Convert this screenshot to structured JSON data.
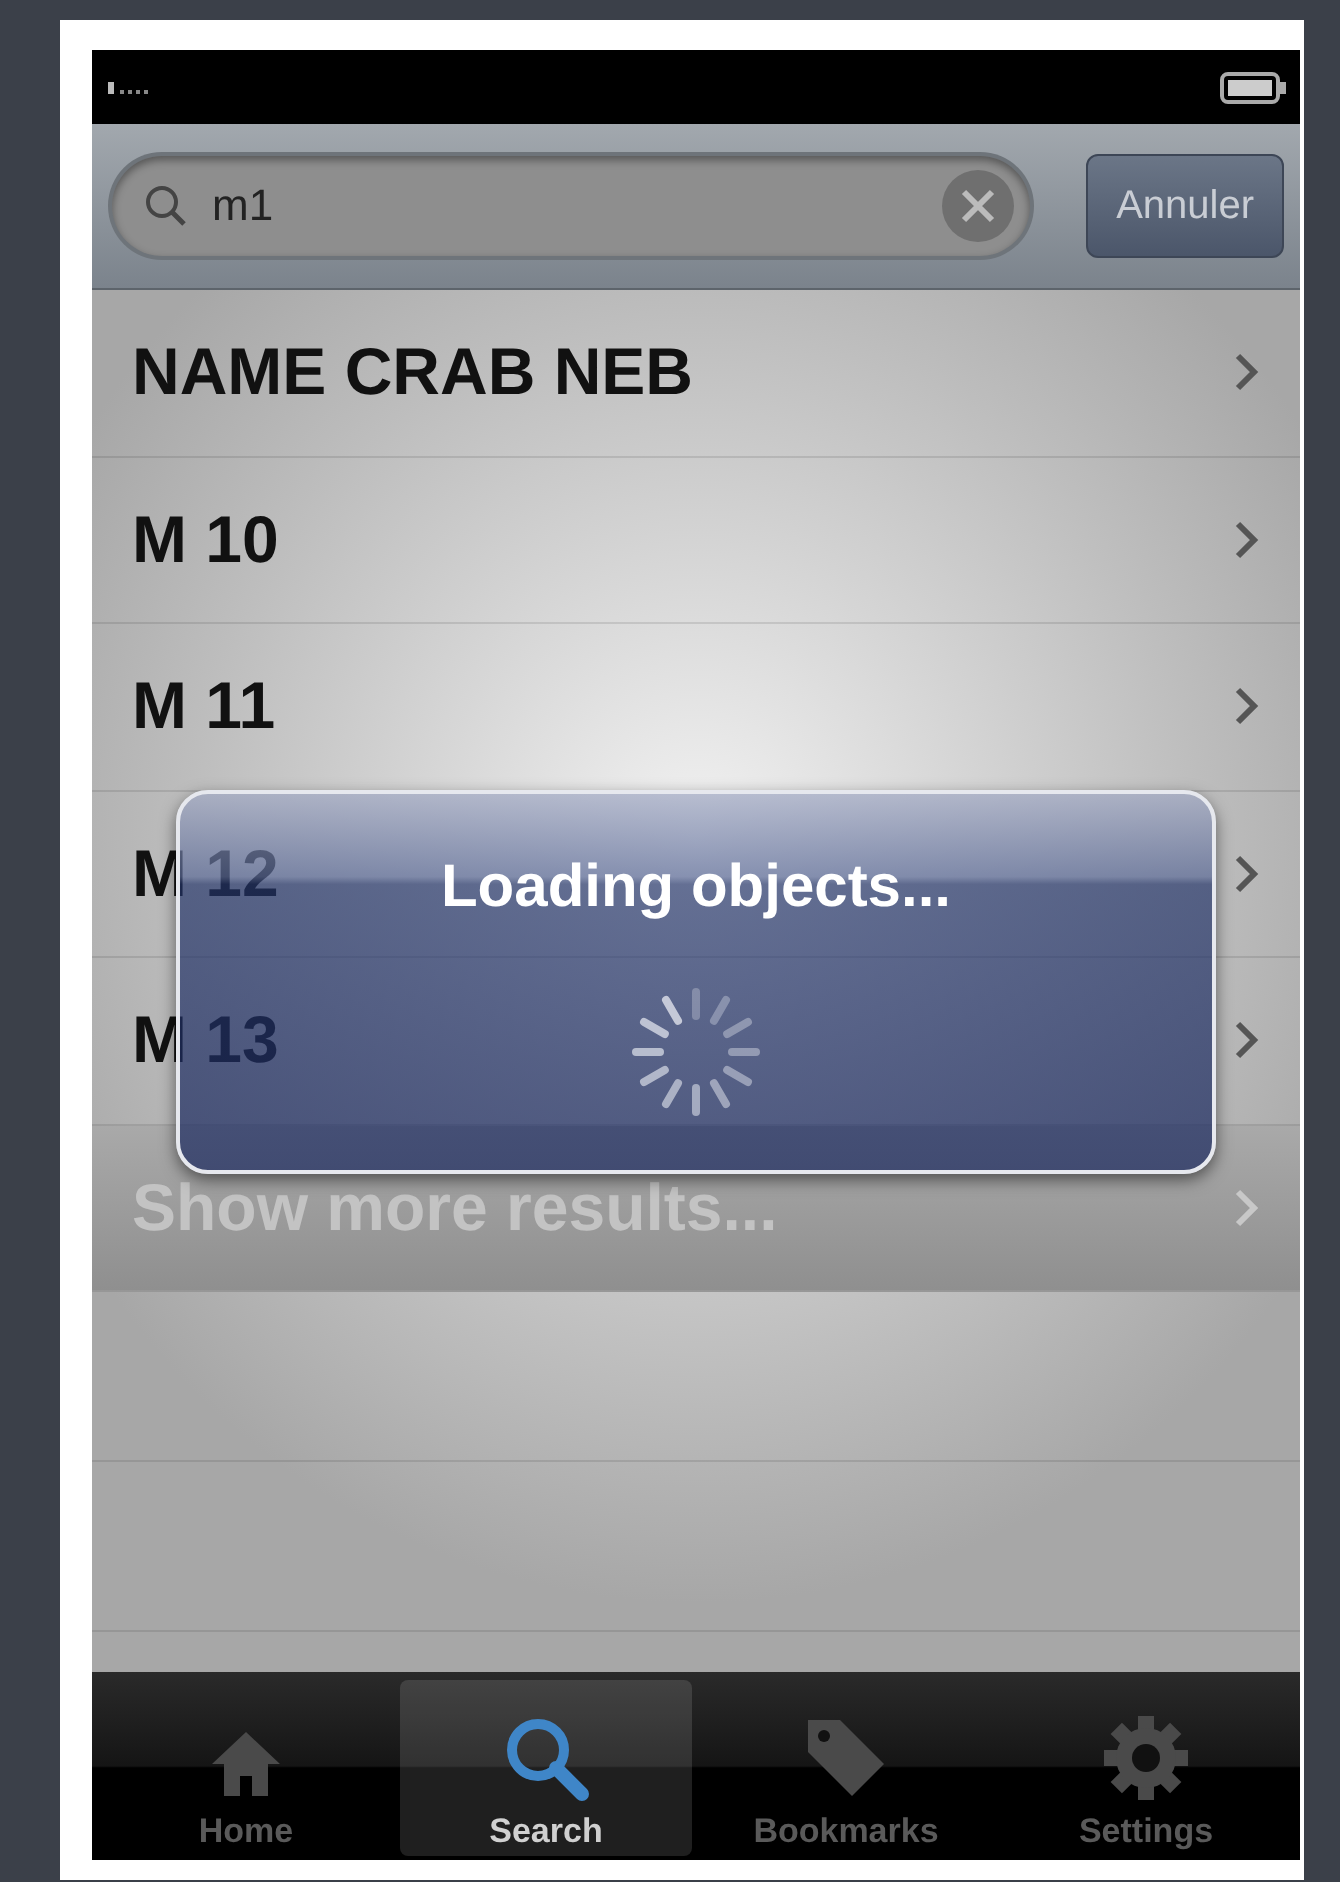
{
  "search": {
    "value": "m1",
    "cancel_label": "Annuler"
  },
  "results": [
    {
      "title": "NAME CRAB NEB",
      "kind": "result",
      "disabled": false
    },
    {
      "title": "M  10",
      "kind": "result",
      "disabled": false
    },
    {
      "title": "M  11",
      "kind": "result",
      "disabled": false
    },
    {
      "title": "M  12",
      "kind": "result",
      "disabled": false
    },
    {
      "title": "M  13",
      "kind": "result",
      "disabled": false
    },
    {
      "title": "Show more results...",
      "kind": "more",
      "disabled": true
    }
  ],
  "loading": {
    "message": "Loading objects..."
  },
  "tabs": [
    {
      "label": "Home",
      "kind": "home",
      "selected": false
    },
    {
      "label": "Search",
      "kind": "search",
      "selected": true
    },
    {
      "label": "Bookmarks",
      "kind": "bookmarks",
      "selected": false
    },
    {
      "label": "Settings",
      "kind": "settings",
      "selected": false
    }
  ]
}
